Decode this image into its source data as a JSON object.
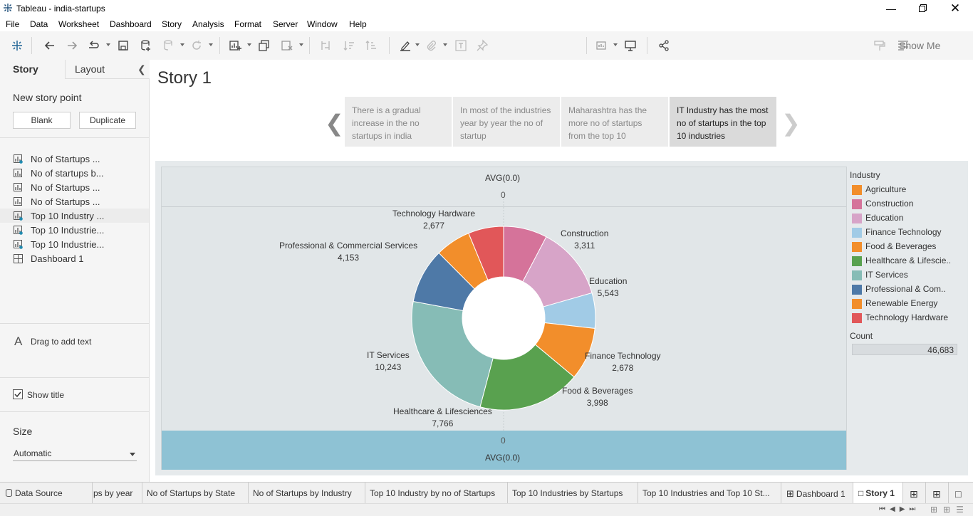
{
  "window": {
    "title": "Tableau - india-startups"
  },
  "menu": [
    "File",
    "Data",
    "Worksheet",
    "Dashboard",
    "Story",
    "Analysis",
    "Format",
    "Server",
    "Window",
    "Help"
  ],
  "toolbar": {
    "show_me": "Show Me"
  },
  "sidebar": {
    "tab_story": "Story",
    "tab_layout": "Layout",
    "new_story_point": "New story point",
    "blank_button": "Blank",
    "duplicate_button": "Duplicate",
    "sheets": [
      {
        "label": "No of Startups ...",
        "type": "chart-used"
      },
      {
        "label": "No of startups b...",
        "type": "chart"
      },
      {
        "label": "No of Startups ...",
        "type": "chart"
      },
      {
        "label": "No of Startups ...",
        "type": "chart"
      },
      {
        "label": "Top 10 Industry ...",
        "type": "chart-used"
      },
      {
        "label": "Top 10 Industrie...",
        "type": "chart-used"
      },
      {
        "label": "Top 10 Industrie...",
        "type": "chart-used"
      },
      {
        "label": "Dashboard 1",
        "type": "dashboard"
      }
    ],
    "drag_text": "Drag to add text",
    "show_title": "Show title",
    "size_title": "Size",
    "size_value": "Automatic"
  },
  "story": {
    "title": "Story 1",
    "points": [
      {
        "text": "There is a gradual increase in the no startups in india"
      },
      {
        "text": "In most of the industries year by year the no of startup"
      },
      {
        "text": "Maharashtra  has the more no of startups from the top 10"
      },
      {
        "text": "IT Industry has the most no of startups in the top 10 industries"
      }
    ]
  },
  "viz": {
    "axis_top_label": "AVG(0.0)",
    "axis_top_tick": "0",
    "axis_bottom_tick": "0",
    "axis_bottom_label": "AVG(0.0)",
    "legend_title": "Industry",
    "count_title": "Count",
    "count_value": "46,683"
  },
  "chart_data": {
    "type": "pie",
    "title": "",
    "categories": [
      "Construction",
      "Education",
      "Finance Technology",
      "Food & Beverages",
      "Healthcare & Lifesciences",
      "IT Services",
      "Professional & Commercial Services",
      "Renewable Energy",
      "Technology Hardware"
    ],
    "values": [
      3311,
      5543,
      2678,
      3998,
      7766,
      10243,
      4153,
      2677,
      2677
    ],
    "value_labels": [
      "3,311",
      "5,543",
      "2,678",
      "3,998",
      "7,766",
      "10,243",
      "4,153",
      "",
      "2,677"
    ],
    "colors": [
      "#d5739a",
      "#d7a4c8",
      "#a1cbe6",
      "#f28e2b",
      "#59a14f",
      "#86bcb6",
      "#4e79a7",
      "#f28e2b",
      "#e15759"
    ],
    "legend": [
      {
        "label": "Agriculture",
        "color": "#f28e2b"
      },
      {
        "label": "Construction",
        "color": "#d5739a"
      },
      {
        "label": "Education",
        "color": "#d7a4c8"
      },
      {
        "label": "Finance Technology",
        "color": "#a1cbe6"
      },
      {
        "label": "Food & Beverages",
        "color": "#f28e2b"
      },
      {
        "label": "Healthcare & Lifescie..",
        "color": "#59a14f"
      },
      {
        "label": "IT Services",
        "color": "#86bcb6"
      },
      {
        "label": "Professional & Com..",
        "color": "#4e79a7"
      },
      {
        "label": "Renewable Energy",
        "color": "#f28e2b"
      },
      {
        "label": "Technology Hardware",
        "color": "#e15759"
      }
    ],
    "legend_placement": "right"
  },
  "sheet_tabs": [
    {
      "label": "Data Source"
    },
    {
      "label": "ps by year"
    },
    {
      "label": "No of Startups by State"
    },
    {
      "label": "No of Startups by Industry"
    },
    {
      "label": "Top 10 Industry by no of Startups"
    },
    {
      "label": "Top 10 Industries by Startups"
    },
    {
      "label": "Top 10 Industries and Top 10 St..."
    },
    {
      "label": "Dashboard 1"
    },
    {
      "label": "Story 1"
    }
  ]
}
